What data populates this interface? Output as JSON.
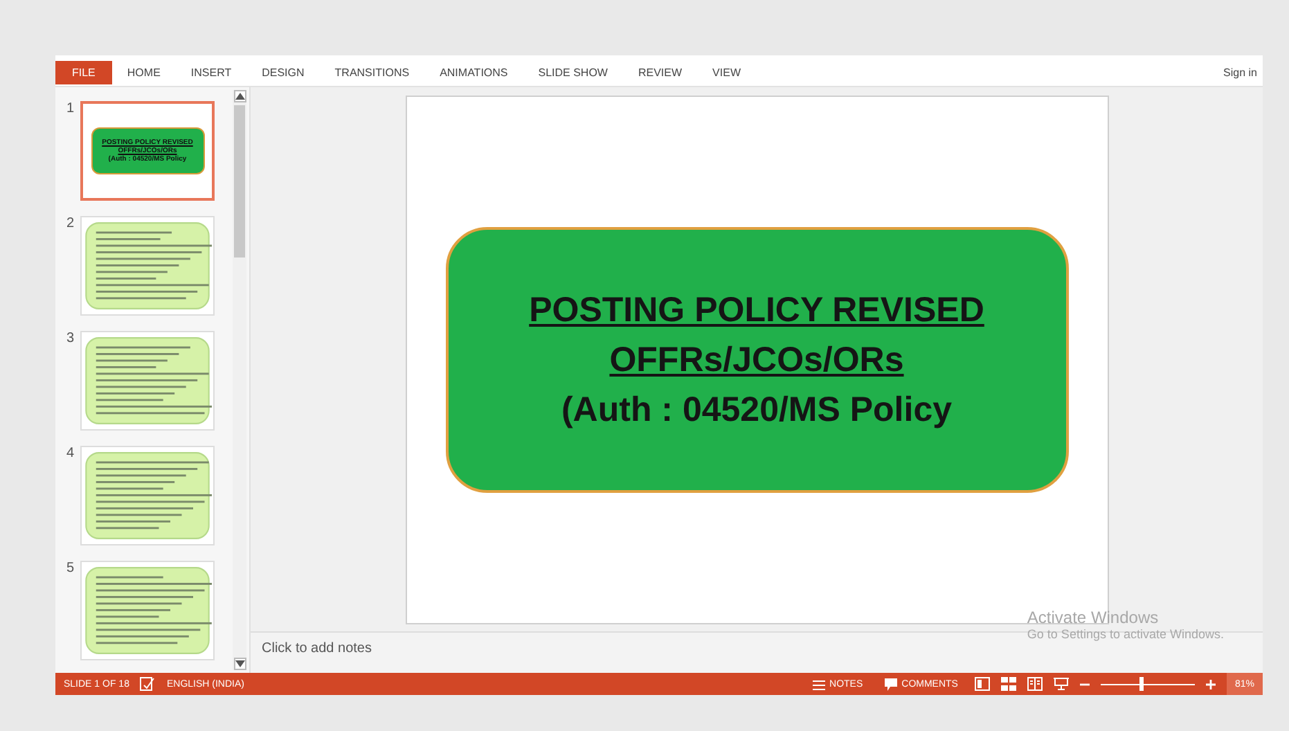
{
  "ribbon": {
    "tabs": [
      {
        "label": "FILE",
        "kind": "file"
      },
      {
        "label": "HOME",
        "kind": "tab"
      },
      {
        "label": "INSERT",
        "kind": "tab"
      },
      {
        "label": "DESIGN",
        "kind": "tab"
      },
      {
        "label": "TRANSITIONS",
        "kind": "tab"
      },
      {
        "label": "ANIMATIONS",
        "kind": "tab"
      },
      {
        "label": "SLIDE SHOW",
        "kind": "tab"
      },
      {
        "label": "REVIEW",
        "kind": "tab"
      },
      {
        "label": "VIEW",
        "kind": "tab"
      }
    ],
    "sign_in": "Sign in"
  },
  "thumbnails": [
    {
      "number": "1",
      "selected": true,
      "kind": "title",
      "lines": [
        {
          "text": "POSTING POLICY REVISED",
          "underlined": true
        },
        {
          "text": "OFFRs/JCOs/ORs",
          "underlined": true
        },
        {
          "text": "(Auth : 04520/MS Policy",
          "underlined": false
        }
      ]
    },
    {
      "number": "2",
      "selected": false,
      "kind": "text"
    },
    {
      "number": "3",
      "selected": false,
      "kind": "text"
    },
    {
      "number": "4",
      "selected": false,
      "kind": "text"
    },
    {
      "number": "5",
      "selected": false,
      "kind": "text"
    }
  ],
  "slide": {
    "lines": [
      {
        "text": "POSTING POLICY REVISED",
        "underlined": true
      },
      {
        "text": "OFFRs/JCOs/ORs",
        "underlined": true
      },
      {
        "text": "(Auth : 04520/MS Policy",
        "underlined": false
      }
    ]
  },
  "notes": {
    "placeholder": "Click to add notes"
  },
  "status_bar": {
    "slide": "SLIDE 1 OF 18",
    "language": "ENGLISH (INDIA)",
    "notes": "NOTES",
    "comments": "COMMENTS",
    "zoom": {
      "level": 0.43
    },
    "zoom_percent": "81%"
  },
  "overlay": {
    "title": "Activate Windows",
    "subtitle": "Go to Settings to activate Windows."
  }
}
